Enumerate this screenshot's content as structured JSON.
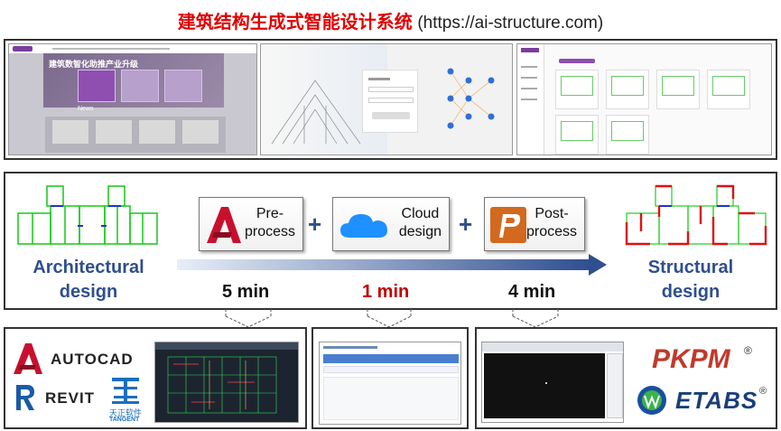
{
  "title": {
    "cn": "建筑结构生成式智能设计系统",
    "url": "(https://ai-structure.com)"
  },
  "top_screens": {
    "home": {
      "banner": "建筑数智化助推产业升级",
      "news": "News"
    }
  },
  "flow": {
    "architectural_label": [
      "Architectural",
      "design"
    ],
    "structural_label": [
      "Structural",
      "design"
    ],
    "steps": [
      {
        "label": [
          "Pre-",
          "process"
        ],
        "icon": "autocad-icon",
        "color": "#c8102e"
      },
      {
        "label": [
          "Cloud",
          "design"
        ],
        "icon": "cloud-icon",
        "color": "#1e90ff"
      },
      {
        "label": [
          "Post-",
          "process"
        ],
        "icon": "pkpm-p-icon",
        "color": "#d2691e"
      }
    ],
    "plus": "+",
    "times": [
      {
        "value": "5 min",
        "color": "#111111"
      },
      {
        "value": "1 min",
        "color": "#c00000"
      },
      {
        "value": "4 min",
        "color": "#111111"
      }
    ],
    "arrow_color": "#2f4f8f"
  },
  "bottom": {
    "left_brands": {
      "autocad": "AUTOCAD",
      "revit": "REVIT",
      "tangent_cn": "天正软件",
      "tangent_en": "TANGENT"
    },
    "right_brands": {
      "pkpm": "PKPM",
      "etabs": "ETABS",
      "registered": "®"
    }
  },
  "colors": {
    "title_red": "#e00000",
    "label_blue": "#2f4f8f",
    "plan_green": "#22cc22",
    "plan_red": "#dd1111",
    "plan_blue": "#2233cc"
  }
}
